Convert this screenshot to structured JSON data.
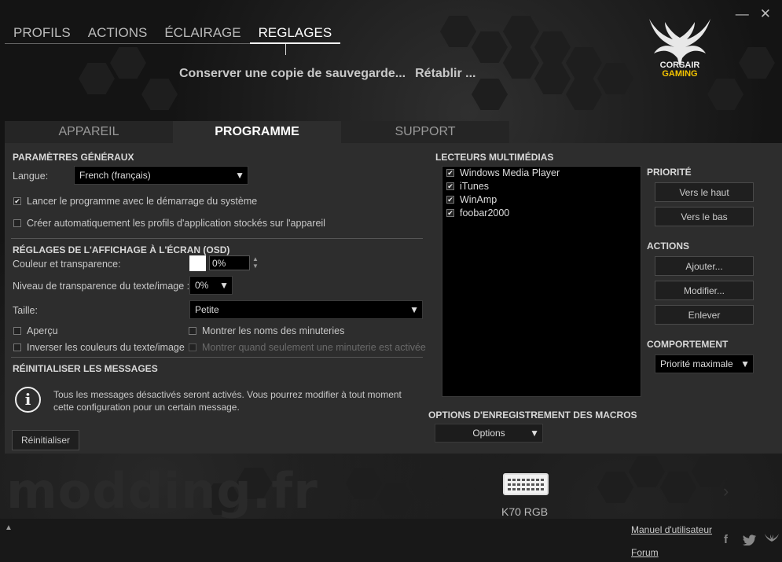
{
  "window": {
    "minimize": "—",
    "close": "✕"
  },
  "topnav": {
    "tabs": [
      "PROFILS",
      "ACTIONS",
      "ÉCLAIRAGE",
      "REGLAGES"
    ],
    "active": "REGLAGES"
  },
  "backup": {
    "save": "Conserver une copie de sauvegarde...",
    "restore": "Rétablir ..."
  },
  "logo": {
    "line1": "CORSAIR",
    "line2": "GAMING"
  },
  "subtabs": {
    "items": [
      "APPAREIL",
      "PROGRAMME",
      "SUPPORT"
    ],
    "active": "PROGRAMME"
  },
  "general": {
    "title": "PARAMÈTRES GÉNÉRAUX",
    "language_label": "Langue:",
    "language_value": "French (français)",
    "launch_on_startup": {
      "label": "Lancer le programme avec le démarrage du système",
      "checked": true
    },
    "auto_create_profiles": {
      "label": "Créer automatiquement les profils d'application stockés sur l'appareil",
      "checked": false
    }
  },
  "osd": {
    "title": "RÉGLAGES DE L'AFFICHAGE À L'ÉCRAN (OSD)",
    "color_label": "Couleur et transparence:",
    "color_swatch": "#ffffff",
    "color_value": "0%",
    "text_transparency_label": "Niveau de transparence du texte/image :",
    "text_transparency_value": "0%",
    "size_label": "Taille:",
    "size_value": "Petite",
    "preview": {
      "label": "Aperçu",
      "checked": false
    },
    "show_timer_names": {
      "label": "Montrer les noms des minuteries",
      "checked": false
    },
    "invert_colors": {
      "label": "Inverser les couleurs du texte/image",
      "checked": false
    },
    "show_single_timer": {
      "label": "Montrer quand seulement une minuterie est activée",
      "checked": false
    }
  },
  "reset": {
    "title": "RÉINITIALISER LES MESSAGES",
    "info_icon": "i",
    "message_line1": "Tous les messages désactivés seront activés. Vous pourrez modifier à tout moment",
    "message_line2": "cette configuration pour un certain message.",
    "button": "Réinitialiser"
  },
  "media": {
    "title": "LECTEURS MULTIMÉDIAS",
    "players": [
      {
        "name": "Windows Media Player",
        "checked": true
      },
      {
        "name": "iTunes",
        "checked": true
      },
      {
        "name": "WinAmp",
        "checked": true
      },
      {
        "name": "foobar2000",
        "checked": true
      }
    ]
  },
  "priority": {
    "title": "PRIORITÉ",
    "up": "Vers le haut",
    "down": "Vers le bas"
  },
  "actions": {
    "title": "ACTIONS",
    "add": "Ajouter...",
    "edit": "Modifier...",
    "remove": "Enlever"
  },
  "behavior": {
    "title": "COMPORTEMENT",
    "value": "Priorité maximale"
  },
  "macros": {
    "title": "OPTIONS D'ENREGISTREMENT DES MACROS",
    "button": "Options"
  },
  "watermark": "modding.fr",
  "device": {
    "name": "K70 RGB"
  },
  "footer": {
    "manual": "Manuel d'utilisateur",
    "forum": "Forum",
    "up_arrow": "▲"
  }
}
